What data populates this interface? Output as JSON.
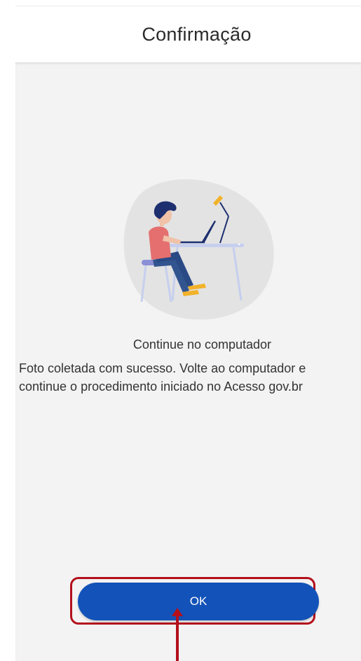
{
  "header": {
    "title": "Confirmação"
  },
  "illustration": {
    "icon": "person-at-computer-illustration"
  },
  "content": {
    "subtitle": "Continue no computador",
    "message": "Foto coletada com sucesso. Volte ao computador e continue o procedimento iniciado no Acesso gov.br"
  },
  "actions": {
    "ok_label": "OK"
  },
  "annotation": {
    "highlight_color": "#b3101c",
    "arrow_icon": "up-arrow-icon"
  },
  "colors": {
    "primary": "#1352b8",
    "background": "#f3f3f3"
  }
}
